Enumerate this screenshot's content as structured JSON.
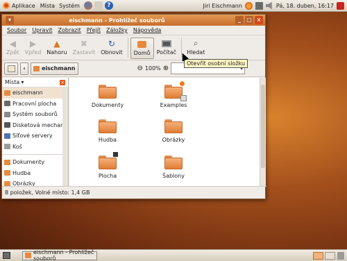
{
  "top_panel": {
    "menus": [
      "Aplikace",
      "Místa",
      "Systém"
    ],
    "user": "Jiri Eischmann",
    "clock": "Pá, 18. duben, 16:17"
  },
  "window": {
    "title": "eischmann - Prohlížeč souborů",
    "menubar": [
      "Soubor",
      "Upravit",
      "Zobrazit",
      "Přejít",
      "Záložky",
      "Nápověda"
    ],
    "toolbar": {
      "back": "Zpět",
      "forward": "Vpřed",
      "up": "Nahoru",
      "stop": "Zastavit",
      "reload": "Obnovit",
      "home": "Domů",
      "computer": "Počítač",
      "search": "Hledat"
    },
    "location": {
      "path_button": "eischmann",
      "zoom": "100%",
      "view_mode": "Zobrazit jako ikony"
    },
    "tooltip": "Otevřít osobní složku",
    "sidebar": {
      "header": "Místa",
      "items": [
        "eischmann",
        "Pracovní plocha",
        "Systém souborů",
        "Disketová mechanika",
        "Síťové servery",
        "Koš"
      ],
      "bookmarks": [
        "Dokumenty",
        "Hudba",
        "Obrázky"
      ]
    },
    "files": [
      "Dokumenty",
      "Examples",
      "Hudba",
      "Obrázky",
      "Plocha",
      "Šablony"
    ],
    "status": "8 položek, Volné místo: 1,4 GB"
  },
  "taskbar": {
    "task_label": "eischmann - Prohlížeč souborů"
  },
  "colors": {
    "accent": "#e07e36",
    "titlebar": "#c66e2b",
    "selection": "#f1e2d0"
  }
}
